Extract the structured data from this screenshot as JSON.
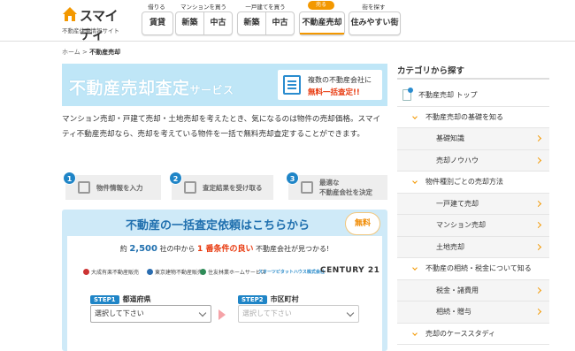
{
  "header": {
    "logo_text": "スマイティ",
    "logo_sub": "不動産住宅情報サイト",
    "nav_groups": [
      {
        "caption": "借りる",
        "buttons": [
          "賃貸"
        ]
      },
      {
        "caption": "マンションを買う",
        "buttons": [
          "新築",
          "中古"
        ]
      },
      {
        "caption": "一戸建てを買う",
        "buttons": [
          "新築",
          "中古"
        ]
      },
      {
        "caption": "売る",
        "buttons": [
          "不動産売却"
        ]
      },
      {
        "caption": "街を探す",
        "buttons": [
          "住みやすい街"
        ]
      }
    ]
  },
  "breadcrumb": {
    "home": "ホーム",
    "sep": ">",
    "current": "不動産売却"
  },
  "banner": {
    "title": "不動産売却査定",
    "title_small": "サービス",
    "box_line1": "複数の不動産会社に",
    "box_line2": "無料一括査定!!"
  },
  "intro": "マンション売却・戸建て売却・土地売却を考えたとき、気になるのは物件の売却価格。スマイティ不動産売却なら、売却を考えている物件を一括で無料売却査定することができます。",
  "steps": [
    {
      "num": "1",
      "label": "物件情報を入力"
    },
    {
      "num": "2",
      "label": "査定結果を受け取る"
    },
    {
      "num": "3",
      "label_line1": "最適な",
      "label_line2": "不動産会社を決定"
    }
  ],
  "form": {
    "heading": "不動産の一括査定依頼はこちらから",
    "free_badge": "無料",
    "lead_a": "約",
    "lead_num": "2,500",
    "lead_b": "社の中から",
    "lead_c": "1 番条件の良い",
    "lead_d": "不動産会社が見つかる!",
    "brands": [
      "大成有楽不動産販売",
      "東京建物不動産販売",
      "住友林業ホームサービス",
      "スターツピタットハウス株式会社",
      "CENTURY 21"
    ],
    "step1_tag": "STEP1",
    "step1_label": "都道府県",
    "step1_placeholder": "選択して下さい",
    "step2_tag": "STEP2",
    "step2_label": "市区町村",
    "step2_placeholder": "選択して下さい"
  },
  "sidebar": {
    "heading": "カテゴリから探す",
    "items": [
      {
        "label": "不動産売却 トップ"
      },
      {
        "label": "不動産売却の基礎を知る"
      },
      {
        "label": "基礎知識"
      },
      {
        "label": "売却ノウハウ"
      },
      {
        "label": "物件種別ごとの売却方法"
      },
      {
        "label": "一戸建て売却"
      },
      {
        "label": "マンション売却"
      },
      {
        "label": "土地売却"
      },
      {
        "label": "不動産の相続・税金について知る"
      },
      {
        "label": "税金・諸費用"
      },
      {
        "label": "相続・贈与"
      },
      {
        "label": "売却のケーススタディ"
      }
    ]
  },
  "colors": {
    "accent": "#f39800",
    "brand_blue": "#1f85c7",
    "banner_bg": "#bfe6f7",
    "form_bg": "#cfeaf8",
    "red": "#e8380d"
  }
}
